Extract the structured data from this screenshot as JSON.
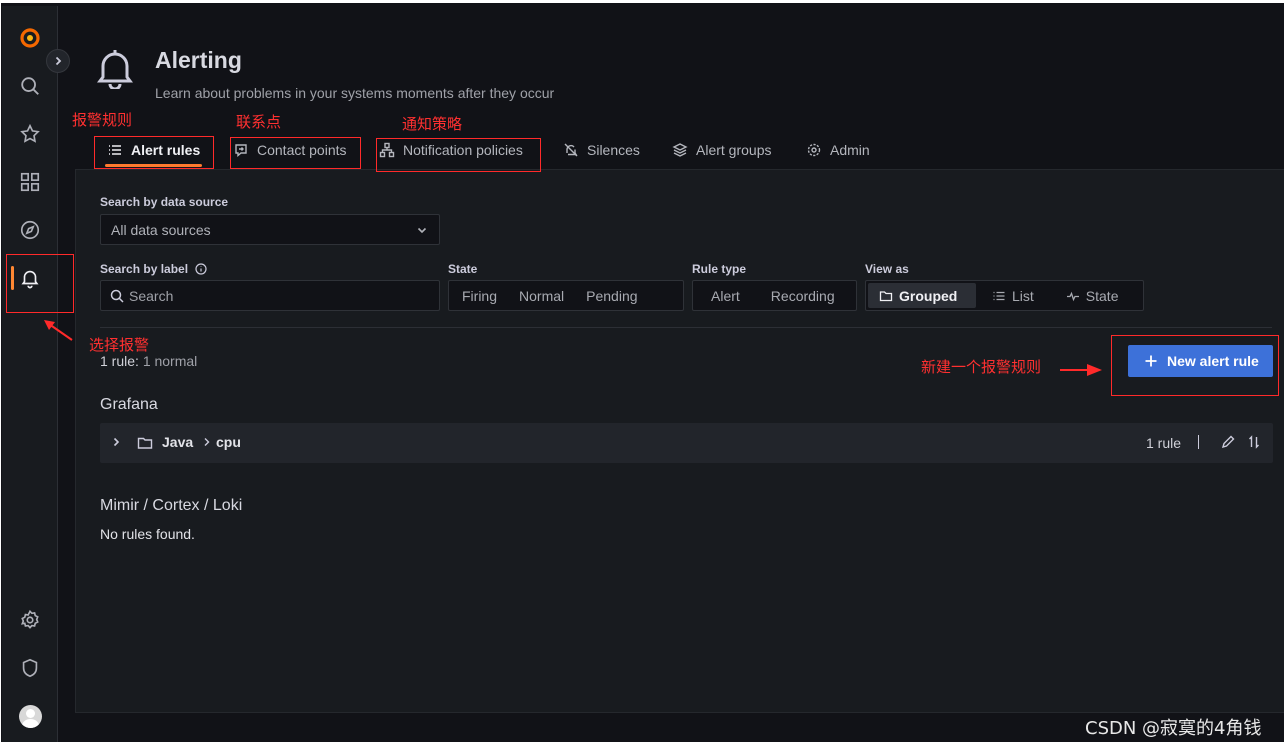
{
  "header": {
    "title": "Alerting",
    "subtitle": "Learn about problems in your systems moments after they occur"
  },
  "tabs": [
    {
      "label": "Alert rules",
      "icon": "list-icon",
      "active": true
    },
    {
      "label": "Contact points",
      "icon": "comment-alt-share-icon"
    },
    {
      "label": "Notification policies",
      "icon": "sitemap-icon"
    },
    {
      "label": "Silences",
      "icon": "bell-slash-icon"
    },
    {
      "label": "Alert groups",
      "icon": "layer-group-icon"
    },
    {
      "label": "Admin",
      "icon": "cog-icon"
    }
  ],
  "filters": {
    "datasource_label": "Search by data source",
    "datasource_value": "All data sources",
    "label_label": "Search by label",
    "search_placeholder": "Search",
    "state_label": "State",
    "state_options": [
      "Firing",
      "Normal",
      "Pending"
    ],
    "ruletype_label": "Rule type",
    "ruletype_options": [
      "Alert",
      "Recording"
    ],
    "viewas_label": "View as",
    "viewas_options": [
      "Grouped",
      "List",
      "State"
    ],
    "viewas_selected": "Grouped"
  },
  "summary": {
    "count": "1 rule:",
    "detail": "1 normal"
  },
  "new_rule_button": "New alert rule",
  "grafana_section": {
    "title": "Grafana",
    "group": {
      "folder": "Java",
      "name": "cpu",
      "rule_count": "1 rule"
    }
  },
  "external_section": {
    "title": "Mimir / Cortex / Loki",
    "empty_text": "No rules found."
  },
  "annotations": {
    "alert_rules": "报警规则",
    "contact_points": "联系点",
    "notification_policies": "通知策略",
    "select_alerting": "选择报警",
    "new_rule": "新建一个报警规则"
  },
  "watermark": "CSDN @寂寞的4角钱",
  "colors": {
    "accent": "#ff7a2f",
    "primary_button": "#3d71d9",
    "annotation": "#ff2a2a"
  }
}
